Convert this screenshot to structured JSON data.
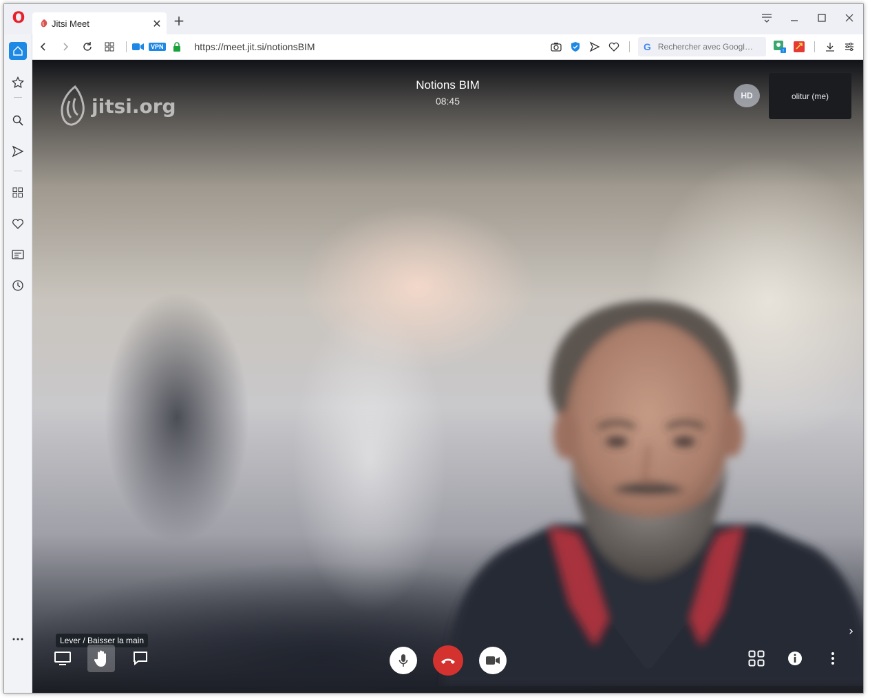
{
  "browser": {
    "tab": {
      "title": "Jitsi Meet",
      "close_label": "✕"
    },
    "new_tab_label": "+",
    "address": {
      "vpn_label": "VPN",
      "url": "https://meet.jit.si/notionsBIM",
      "search_placeholder": "Rechercher avec Googl…"
    }
  },
  "meeting": {
    "logo_text": "jitsi.org",
    "title": "Notions BIM",
    "timer": "08:45",
    "quality_badge": "HD",
    "self_view_label": "olitur (me)",
    "tooltip": "Lever / Baisser la main"
  },
  "colors": {
    "hangup": "#d3322f",
    "accent": "#1e88e5",
    "opera_red": "#e8202a"
  },
  "icons": {
    "sidebar": [
      "home-icon",
      "speed-dial-icon",
      "search-icon",
      "send-icon",
      "extensions-icon",
      "heart-icon",
      "news-icon",
      "history-icon",
      "more-icon"
    ]
  }
}
